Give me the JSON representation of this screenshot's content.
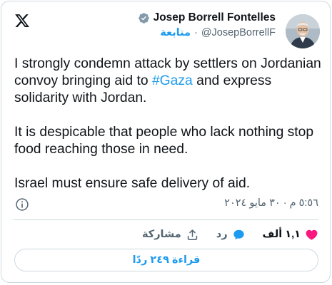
{
  "author": {
    "name": "Josep Borrell Fontelles",
    "handle": "@JosepBorrellF",
    "separator": "·",
    "follow_label": "متابعة"
  },
  "tweet": {
    "paragraph1_before": "I strongly condemn attack by settlers on Jordanian convoy bringing aid to ",
    "hashtag": "#Gaza",
    "paragraph1_after": " and express solidarity with Jordan.",
    "paragraph2": "It is despicable that people who lack nothing stop food reaching those in need.",
    "paragraph3": "Israel must ensure safe delivery of aid."
  },
  "timestamp": "٥:٥٦ م · ٣٠ مايو ٢٠٢٤",
  "actions": {
    "like_count": "١,١ ألف",
    "reply_label": "رد",
    "share_label": "مشاركة"
  },
  "read_replies_label": "قراءة ٢٤٩ ردًا",
  "icons": {
    "logo": "x-logo-icon",
    "verified": "verified-badge-icon",
    "info": "info-icon",
    "like": "heart-icon",
    "reply": "reply-bubble-icon",
    "share": "share-icon"
  },
  "colors": {
    "accent": "#1d9bf0",
    "like": "#f91880",
    "muted": "#536471",
    "text": "#0f1419",
    "border": "#cfd9de"
  }
}
